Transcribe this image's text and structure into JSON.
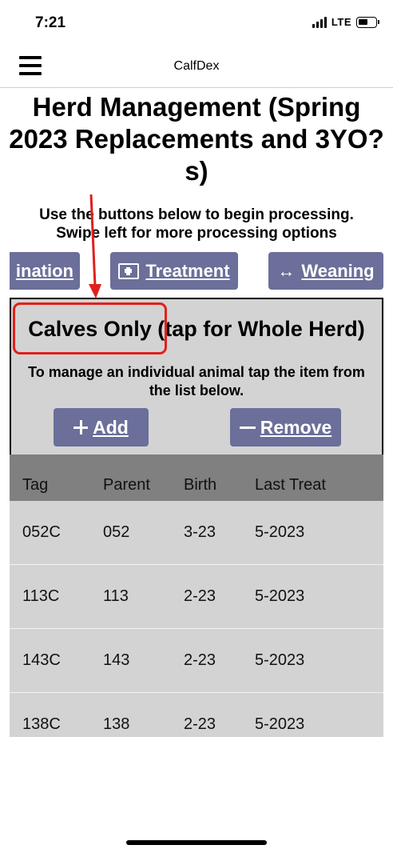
{
  "status_bar": {
    "time": "7:21",
    "network": "LTE"
  },
  "nav": {
    "menu_icon": "hamburger-menu-icon",
    "app_title": "CalfDex"
  },
  "page": {
    "title": "Herd Management (Spring 2023 Replacements and 3YO?s)",
    "instructions_line1": "Use the buttons below to begin processing.",
    "instructions_line2": "Swipe left for more processing options"
  },
  "processing_buttons": [
    {
      "label": "ination",
      "icon": ""
    },
    {
      "label": "Treatment",
      "icon": "medical-kit-icon"
    },
    {
      "label": "Weaning",
      "icon": "left-right-arrow-icon"
    }
  ],
  "panel": {
    "toggle_label": "Calves Only (tap for Whole Herd)",
    "hint": "To manage an individual animal tap the item from the list below.",
    "add_label": "Add",
    "remove_label": "Remove"
  },
  "table": {
    "headers": [
      "Tag",
      "Parent",
      "Birth",
      "Last Treat"
    ],
    "rows": [
      [
        "052C",
        "052",
        "3-23",
        "5-2023"
      ],
      [
        "113C",
        "113",
        "2-23",
        "5-2023"
      ],
      [
        "143C",
        "143",
        "2-23",
        "5-2023"
      ],
      [
        "138C",
        "138",
        "2-23",
        "5-2023"
      ]
    ]
  },
  "colors": {
    "button_bg": "#6b6f99",
    "panel_bg": "#d3d3d3",
    "table_header_bg": "#808080",
    "annotation": "#e0201b"
  }
}
